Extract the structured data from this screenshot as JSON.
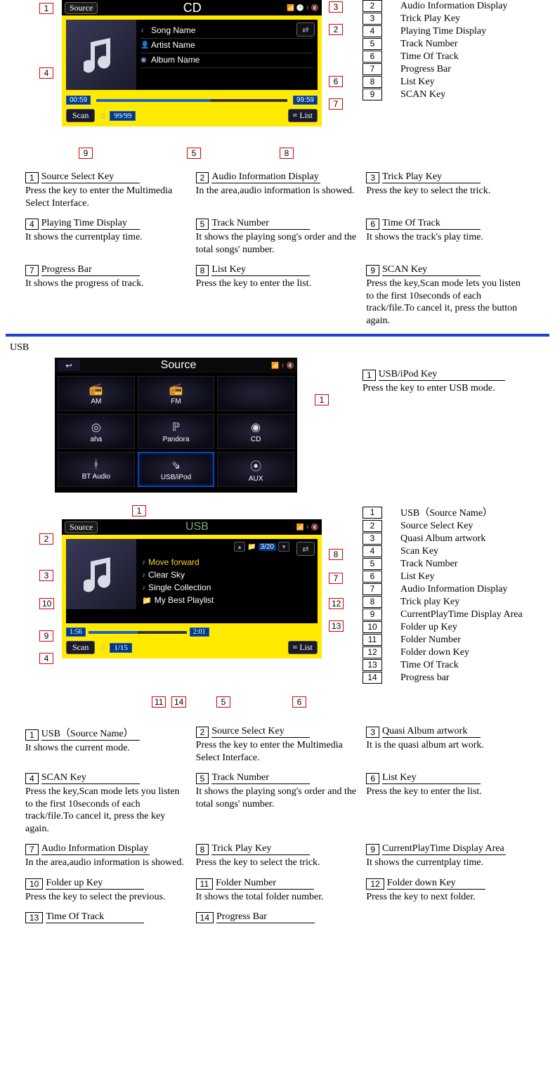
{
  "cd": {
    "title": "CD",
    "source_btn": "Source",
    "info": {
      "song": "Song Name",
      "artist": "Artist Name",
      "album": "Album Name"
    },
    "time_left": "00:59",
    "time_right": "99:59",
    "scan": "Scan",
    "track": "99/99",
    "list": "List",
    "legend": [
      {
        "n": "2",
        "t": "Audio Information Display"
      },
      {
        "n": "3",
        "t": "Trick Play Key"
      },
      {
        "n": "4",
        "t": "Playing Time Display"
      },
      {
        "n": "5",
        "t": "Track Number"
      },
      {
        "n": "6",
        "t": "Time Of Track"
      },
      {
        "n": "7",
        "t": "Progress Bar"
      },
      {
        "n": "8",
        "t": "List Key"
      },
      {
        "n": "9",
        "t": "SCAN Key"
      }
    ],
    "callouts": {
      "c1": "1",
      "c2": "2",
      "c3": "3",
      "c4": "4",
      "c5": "5",
      "c6": "6",
      "c7": "7",
      "c8": "8",
      "c9": "9"
    },
    "desc": [
      {
        "n": "1",
        "t": "Source Select Key",
        "b": "Press the key to enter the Multimedia Select Interface."
      },
      {
        "n": "2",
        "t": "Audio Information Display",
        "b": "In the area,audio information is showed."
      },
      {
        "n": "3",
        "t": "Trick Play Key",
        "b": "Press the key to select the trick."
      },
      {
        "n": "4",
        "t": "Playing Time Display",
        "b": "It shows  the currentplay time."
      },
      {
        "n": "5",
        "t": "Track Number",
        "b": "It shows the playing song's order and the total songs' number."
      },
      {
        "n": "6",
        "t": "Time Of Track",
        "b": "It shows the track's play time."
      },
      {
        "n": "7",
        "t": "Progress Bar",
        "b": "It shows the progress of track."
      },
      {
        "n": "8",
        "t": "List Key",
        "b": "Press the key to enter the list."
      },
      {
        "n": "9",
        "t": "SCAN Key",
        "b": "Press the key,Scan mode lets you listen to the first 10seconds of each track/file.To cancel it, press the button again."
      }
    ]
  },
  "usb_section_label": "USB",
  "usb1": {
    "title": "Source",
    "cells": [
      {
        "ic": "📻",
        "t": "AM"
      },
      {
        "ic": "📻",
        "t": "FM"
      },
      {
        "ic": "",
        "t": ""
      },
      {
        "ic": "◎",
        "t": "aha"
      },
      {
        "ic": "ℙ",
        "t": "Pandora"
      },
      {
        "ic": "◉",
        "t": "CD"
      },
      {
        "ic": "ᚼ",
        "t": "BT Audio"
      },
      {
        "ic": "⇘",
        "t": "USB/iPod"
      },
      {
        "ic": "⦿",
        "t": "AUX"
      }
    ],
    "callout1": "1",
    "note": {
      "n": "1",
      "t": "USB/iPod Key",
      "b": "Press the key to enter USB mode."
    }
  },
  "usb2": {
    "title": "USB",
    "source_btn": "Source",
    "folder_num": "3/20",
    "list_rows": [
      {
        "ico": "♪",
        "t": "Move forward",
        "sel": true
      },
      {
        "ico": "♪",
        "t": "Clear Sky",
        "sel": false
      },
      {
        "ico": "♪",
        "t": "Single Collection",
        "sel": false
      },
      {
        "ico": "📁",
        "t": "My Best Playlist",
        "sel": false
      }
    ],
    "time_left": "1:56",
    "time_right": "2:01",
    "scan": "Scan",
    "track": "1/15",
    "list": "List",
    "callouts": {
      "c1": "1",
      "c2": "2",
      "c3": "3",
      "c4": "4",
      "c5": "5",
      "c6": "6",
      "c7": "7",
      "c8": "8",
      "c9": "9",
      "c10": "10",
      "c11": "11",
      "c12": "12",
      "c13": "13",
      "c14": "14"
    },
    "legend": [
      {
        "n": "1",
        "t": "USB（Source Name）"
      },
      {
        "n": "2",
        "t": "Source Select Key"
      },
      {
        "n": "3",
        "t": "Quasi Album artwork"
      },
      {
        "n": "4",
        "t": "Scan Key"
      },
      {
        "n": "5",
        "t": "Track Number"
      },
      {
        "n": "6",
        "t": "List Key"
      },
      {
        "n": "7",
        "t": "Audio Information Display"
      },
      {
        "n": "8",
        "t": "Trick play Key"
      },
      {
        "n": "9",
        "t": "CurrentPlayTime Display Area"
      },
      {
        "n": "10",
        "t": "Folder up Key"
      },
      {
        "n": "11",
        "t": "Folder Number"
      },
      {
        "n": "12",
        "t": "Folder down Key"
      },
      {
        "n": "13",
        "t": "Time Of Track"
      },
      {
        "n": "14",
        "t": "Progress bar"
      }
    ],
    "desc": [
      {
        "n": "1",
        "t": "USB（Source Name）",
        "b": "It shows the current mode."
      },
      {
        "n": "2",
        "t": "Source Select Key",
        "b": "Press the key to enter the Multimedia Select Interface."
      },
      {
        "n": "3",
        "t": "Quasi Album artwork",
        "b": "It is the quasi album art work."
      },
      {
        "n": "4",
        "t": "SCAN Key",
        "b": "Press the key,Scan mode lets you listen to the first 10seconds of each track/file.To cancel it, press the key again."
      },
      {
        "n": "5",
        "t": "Track Number",
        "b": "It shows the playing song's order and the total songs' number."
      },
      {
        "n": "6",
        "t": "List Key",
        "b": "Press the key to enter the list."
      },
      {
        "n": "7",
        "t": "Audio Information Display",
        "b": "In the area,audio information is showed."
      },
      {
        "n": "8",
        "t": "Trick Play Key",
        "b": "Press the key to select the trick."
      },
      {
        "n": "9",
        "t": "CurrentPlayTime Display Area",
        "b": "It shows  the currentplay time."
      },
      {
        "n": "10",
        "t": "Folder up Key",
        "b": "Press the key to select the previous."
      },
      {
        "n": "11",
        "t": "Folder Number",
        "b": "It shows the total folder number."
      },
      {
        "n": "12",
        "t": "Folder down Key",
        "b": "Press the key to next folder."
      },
      {
        "n": "13",
        "t": "Time Of Track",
        "b": ""
      },
      {
        "n": "14",
        "t": "Progress Bar",
        "b": ""
      }
    ]
  }
}
